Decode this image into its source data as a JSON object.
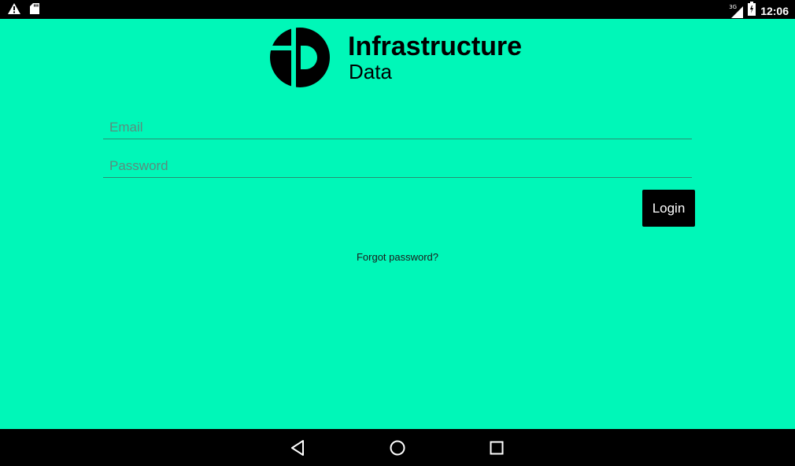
{
  "status_bar": {
    "time": "12:06",
    "network": "3G",
    "icons": [
      "warning-icon",
      "sd-card-icon",
      "signal-icon",
      "battery-icon"
    ]
  },
  "brand": {
    "title": "Infrastructure",
    "subtitle": "Data",
    "logo_icon": "infrastructure-data-logo"
  },
  "form": {
    "email_placeholder": "Email",
    "email_value": "",
    "password_placeholder": "Password",
    "password_value": "",
    "login_label": "Login",
    "forgot_label": "Forgot password?"
  },
  "nav_bar": {
    "icons": [
      "back-icon",
      "home-icon",
      "recents-icon"
    ]
  },
  "colors": {
    "background": "#00f7b8",
    "button": "#000000",
    "bars": "#000000"
  }
}
